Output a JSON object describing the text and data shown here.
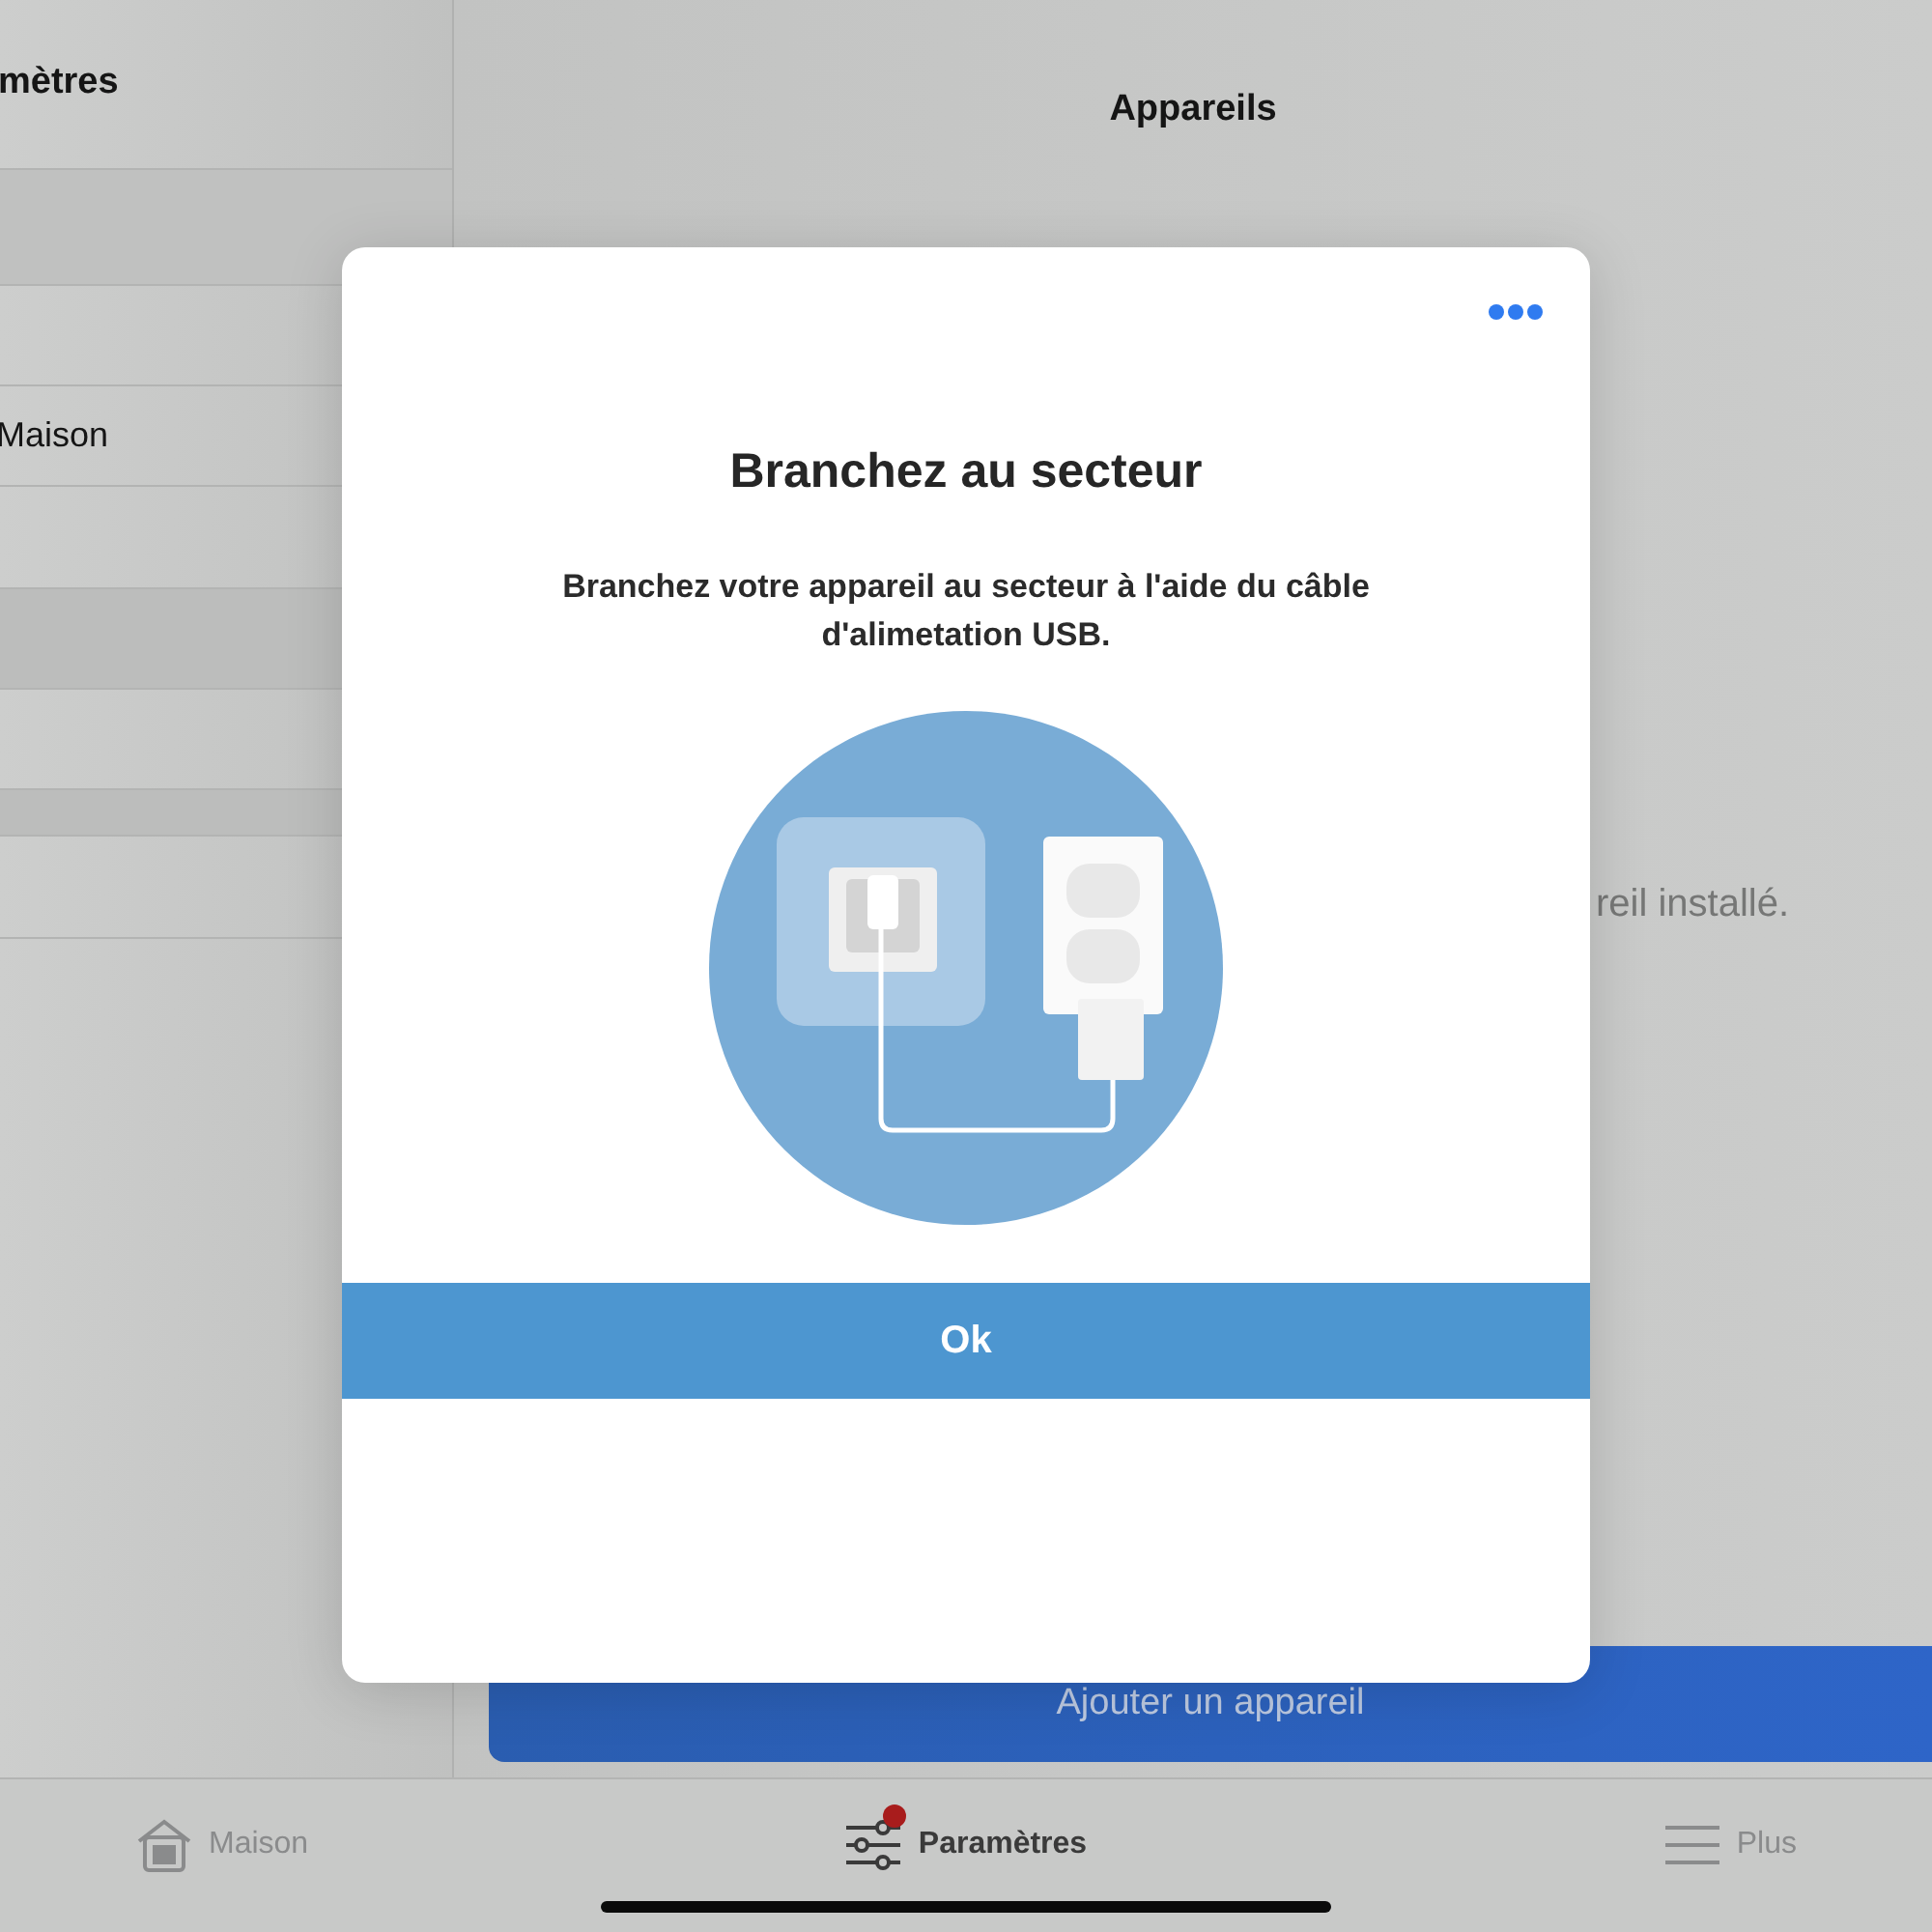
{
  "sidebar": {
    "title": "mètres",
    "items": [
      {
        "label": "Maison"
      }
    ]
  },
  "main": {
    "title": "Appareils",
    "empty_message": "reil installé.",
    "add_button": "Ajouter un appareil"
  },
  "tab_bar": [
    {
      "kind": "home",
      "label": "Maison",
      "selected": false,
      "badge": false
    },
    {
      "kind": "sliders",
      "label": "Paramètres",
      "selected": true,
      "badge": true
    },
    {
      "kind": "menu",
      "label": "Plus",
      "selected": false,
      "badge": false
    }
  ],
  "dialog": {
    "title": "Branchez au secteur",
    "message": "Branchez votre appareil au secteur à l'aide du câble d'alimetation USB.",
    "button": "Ok"
  }
}
